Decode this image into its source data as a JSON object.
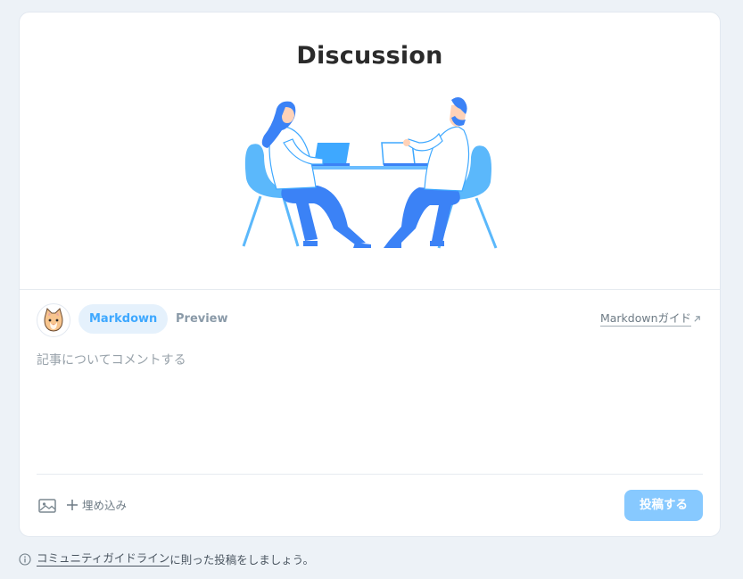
{
  "discussion": {
    "title": "Discussion",
    "illustration_icon": "two-people-at-table-illustration"
  },
  "editor": {
    "avatar_icon": "cat-avatar-icon",
    "tabs": [
      {
        "label": "Markdown",
        "active": true
      },
      {
        "label": "Preview",
        "active": false
      }
    ],
    "guide_link": "Markdownガイド",
    "placeholder": "記事についてコメントする",
    "value": "",
    "image_icon": "image-icon",
    "embed_label": "埋め込み",
    "submit_label": "投稿する"
  },
  "footer": {
    "link_text": "コミュニティガイドライン",
    "suffix_text": "に則った投稿をしましょう。"
  },
  "colors": {
    "accent": "#3ea8ff",
    "accent_light": "#e5f1fc",
    "submit_disabled": "#87c9ff",
    "background": "#edf2f7"
  }
}
